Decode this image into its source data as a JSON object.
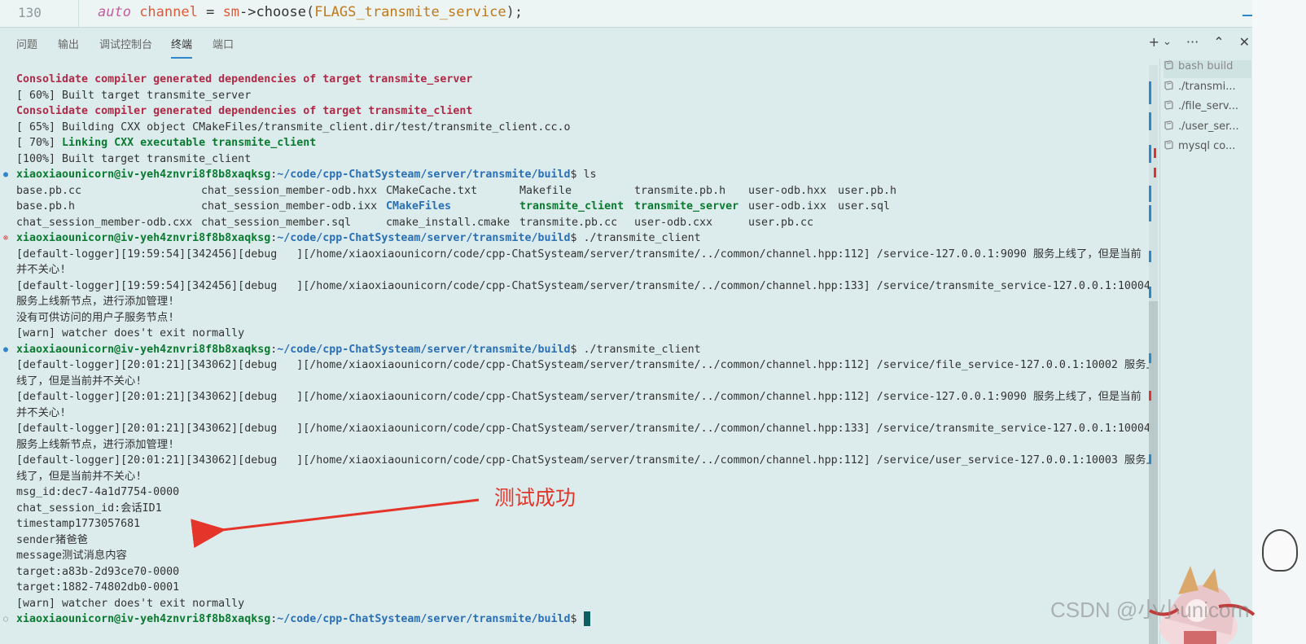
{
  "editor": {
    "line_number": "130",
    "code_tokens": {
      "kw": "auto",
      "var": " channel",
      "eq": " = ",
      "obj": "sm",
      "arrow": "->",
      "fn": "choose",
      "lp": "(",
      "arg": "FLAGS_transmite_service",
      "rp": ");"
    }
  },
  "panel": {
    "tabs": [
      "问题",
      "输出",
      "调试控制台",
      "终端",
      "端口"
    ],
    "active_tab": "终端",
    "actions": [
      "+",
      "⌄",
      "···",
      "⌃",
      "✕"
    ]
  },
  "terminal": {
    "lines": [
      {
        "dot": "",
        "parts": [
          {
            "c": "mag",
            "t": "Consolidate compiler generated dependencies of target transmite_server"
          }
        ]
      },
      {
        "dot": "",
        "parts": [
          {
            "c": "",
            "t": "[ 60%] Built target transmite_server"
          }
        ]
      },
      {
        "dot": "",
        "parts": [
          {
            "c": "mag",
            "t": "Consolidate compiler generated dependencies of target transmite_client"
          }
        ]
      },
      {
        "dot": "",
        "parts": [
          {
            "c": "",
            "t": "[ 65%] Building CXX object CMakeFiles/transmite_client.dir/test/transmite_client.cc.o"
          }
        ]
      },
      {
        "dot": "",
        "parts": [
          {
            "c": "",
            "t": "[ 70%] "
          },
          {
            "c": "grn",
            "t": "Linking CXX executable transmite_client"
          }
        ]
      },
      {
        "dot": "",
        "parts": [
          {
            "c": "",
            "t": "[100%] Built target transmite_client"
          }
        ]
      },
      {
        "dot": "blue",
        "parts": [
          {
            "c": "prompt",
            "t": "xiaoxiaounicorn@iv-yeh4znvri8f8b8xaqksg"
          },
          {
            "c": "",
            "t": ":"
          },
          {
            "c": "path",
            "t": "~/code/cpp-ChatSysteam/server/transmite/build"
          },
          {
            "c": "",
            "t": "$ ls"
          }
        ]
      },
      {
        "dot": "",
        "cols": [
          {
            "c": "",
            "t": "base.pb.cc"
          },
          {
            "c": "",
            "t": "chat_session_member-odb.hxx"
          },
          {
            "c": "",
            "t": "CMakeCache.txt"
          },
          {
            "c": "",
            "t": "Makefile"
          },
          {
            "c": "",
            "t": "transmite.pb.h"
          },
          {
            "c": "",
            "t": "user-odb.hxx"
          },
          {
            "c": "",
            "t": "user.pb.h"
          }
        ]
      },
      {
        "dot": "",
        "cols": [
          {
            "c": "",
            "t": "base.pb.h"
          },
          {
            "c": "",
            "t": "chat_session_member-odb.ixx"
          },
          {
            "c": "blu",
            "t": "CMakeFiles"
          },
          {
            "c": "grn",
            "t": "transmite_client"
          },
          {
            "c": "grn",
            "t": "transmite_server"
          },
          {
            "c": "",
            "t": "user-odb.ixx"
          },
          {
            "c": "",
            "t": "user.sql"
          }
        ]
      },
      {
        "dot": "",
        "cols": [
          {
            "c": "",
            "t": "chat_session_member-odb.cxx"
          },
          {
            "c": "",
            "t": "chat_session_member.sql"
          },
          {
            "c": "",
            "t": "cmake_install.cmake"
          },
          {
            "c": "",
            "t": "transmite.pb.cc"
          },
          {
            "c": "",
            "t": "user-odb.cxx"
          },
          {
            "c": "",
            "t": "user.pb.cc"
          },
          {
            "c": "",
            "t": ""
          }
        ]
      },
      {
        "dot": "red",
        "parts": [
          {
            "c": "prompt",
            "t": "xiaoxiaounicorn@iv-yeh4znvri8f8b8xaqksg"
          },
          {
            "c": "",
            "t": ":"
          },
          {
            "c": "path",
            "t": "~/code/cpp-ChatSysteam/server/transmite/build"
          },
          {
            "c": "",
            "t": "$ ./transmite_client"
          }
        ]
      },
      {
        "dot": "",
        "parts": [
          {
            "c": "",
            "t": "[default-logger][19:59:54][342456][debug   ][/home/xiaoxiaounicorn/code/cpp-ChatSysteam/server/transmite/../common/channel.hpp:112] /service-127.0.0.1:9090 服务上线了，但是当前"
          }
        ]
      },
      {
        "dot": "",
        "parts": [
          {
            "c": "",
            "t": "并不关心!"
          }
        ]
      },
      {
        "dot": "",
        "parts": [
          {
            "c": "",
            "t": "[default-logger][19:59:54][342456][debug   ][/home/xiaoxiaounicorn/code/cpp-ChatSysteam/server/transmite/../common/channel.hpp:133] /service/transmite_service-127.0.0.1:10004"
          }
        ]
      },
      {
        "dot": "",
        "parts": [
          {
            "c": "",
            "t": "服务上线新节点，进行添加管理!"
          }
        ]
      },
      {
        "dot": "",
        "parts": [
          {
            "c": "",
            "t": "没有可供访问的用户子服务节点!"
          }
        ]
      },
      {
        "dot": "",
        "parts": [
          {
            "c": "",
            "t": "[warn] watcher does't exit normally"
          }
        ]
      },
      {
        "dot": "blue",
        "parts": [
          {
            "c": "prompt",
            "t": "xiaoxiaounicorn@iv-yeh4znvri8f8b8xaqksg"
          },
          {
            "c": "",
            "t": ":"
          },
          {
            "c": "path",
            "t": "~/code/cpp-ChatSysteam/server/transmite/build"
          },
          {
            "c": "",
            "t": "$ ./transmite_client"
          }
        ]
      },
      {
        "dot": "",
        "parts": [
          {
            "c": "",
            "t": "[default-logger][20:01:21][343062][debug   ][/home/xiaoxiaounicorn/code/cpp-ChatSysteam/server/transmite/../common/channel.hpp:112] /service/file_service-127.0.0.1:10002 服务上"
          }
        ]
      },
      {
        "dot": "",
        "parts": [
          {
            "c": "",
            "t": "线了，但是当前并不关心!"
          }
        ]
      },
      {
        "dot": "",
        "parts": [
          {
            "c": "",
            "t": "[default-logger][20:01:21][343062][debug   ][/home/xiaoxiaounicorn/code/cpp-ChatSysteam/server/transmite/../common/channel.hpp:112] /service-127.0.0.1:9090 服务上线了，但是当前"
          }
        ]
      },
      {
        "dot": "",
        "parts": [
          {
            "c": "",
            "t": "并不关心!"
          }
        ]
      },
      {
        "dot": "",
        "parts": [
          {
            "c": "",
            "t": "[default-logger][20:01:21][343062][debug   ][/home/xiaoxiaounicorn/code/cpp-ChatSysteam/server/transmite/../common/channel.hpp:133] /service/transmite_service-127.0.0.1:10004"
          }
        ]
      },
      {
        "dot": "",
        "parts": [
          {
            "c": "",
            "t": "服务上线新节点，进行添加管理!"
          }
        ]
      },
      {
        "dot": "",
        "parts": [
          {
            "c": "",
            "t": "[default-logger][20:01:21][343062][debug   ][/home/xiaoxiaounicorn/code/cpp-ChatSysteam/server/transmite/../common/channel.hpp:112] /service/user_service-127.0.0.1:10003 服务上"
          }
        ]
      },
      {
        "dot": "",
        "parts": [
          {
            "c": "",
            "t": "线了，但是当前并不关心!"
          }
        ]
      },
      {
        "dot": "",
        "parts": [
          {
            "c": "",
            "t": "msg_id:dec7-4a1d7754-0000"
          }
        ]
      },
      {
        "dot": "",
        "parts": [
          {
            "c": "",
            "t": "chat_session_id:会话ID1"
          }
        ]
      },
      {
        "dot": "",
        "parts": [
          {
            "c": "",
            "t": "timestamp1773057681"
          }
        ]
      },
      {
        "dot": "",
        "parts": [
          {
            "c": "",
            "t": "sender猪爸爸"
          }
        ]
      },
      {
        "dot": "",
        "parts": [
          {
            "c": "",
            "t": "message测试消息内容"
          }
        ]
      },
      {
        "dot": "",
        "parts": [
          {
            "c": "",
            "t": "target:a83b-2d93ce70-0000"
          }
        ]
      },
      {
        "dot": "",
        "parts": [
          {
            "c": "",
            "t": "target:1882-74802db0-0001"
          }
        ]
      },
      {
        "dot": "",
        "parts": [
          {
            "c": "",
            "t": "[warn] watcher does't exit normally"
          }
        ]
      },
      {
        "dot": "grey",
        "parts": [
          {
            "c": "prompt",
            "t": "xiaoxiaounicorn@iv-yeh4znvri8f8b8xaqksg"
          },
          {
            "c": "",
            "t": ":"
          },
          {
            "c": "path",
            "t": "~/code/cpp-ChatSysteam/server/transmite/build"
          },
          {
            "c": "",
            "t": "$ "
          }
        ],
        "cursor": true
      }
    ]
  },
  "sessions": [
    {
      "label": "bash  build",
      "active": true
    },
    {
      "label": "./transmi...",
      "active": false
    },
    {
      "label": "./file_serv...",
      "active": false
    },
    {
      "label": "./user_ser...",
      "active": false
    },
    {
      "label": "mysql  co...",
      "active": false
    }
  ],
  "annotation": {
    "label": "测试成功"
  },
  "watermark": "CSDN @小小unicorn",
  "colors": {
    "accent": "#2f86c8",
    "annotation_red": "#e5342a",
    "terminal_bg": "#dcecec"
  }
}
